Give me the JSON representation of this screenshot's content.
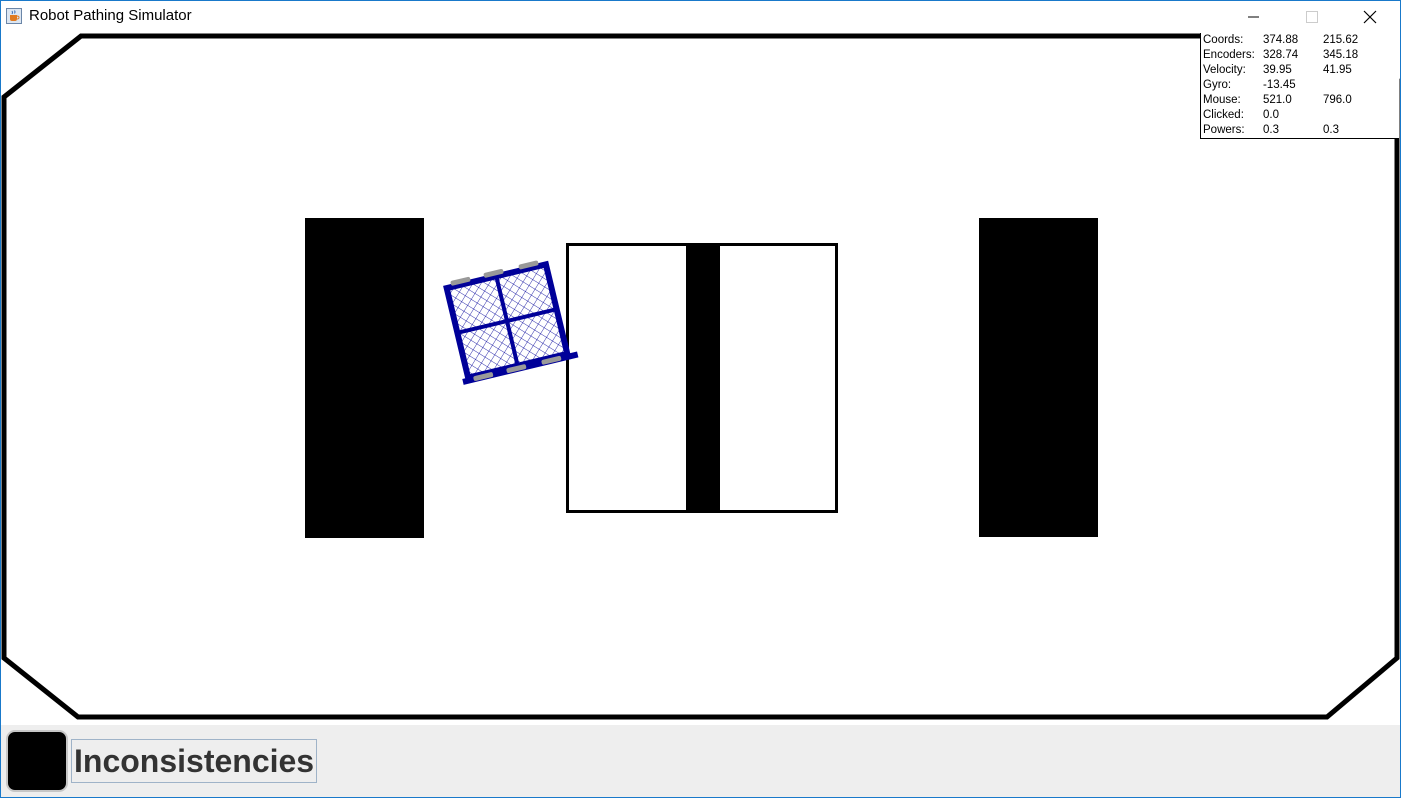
{
  "window": {
    "title": "Robot Pathing Simulator",
    "icon": "java-cup-icon",
    "controls": [
      "minimize-icon",
      "maximize-icon",
      "close-icon"
    ]
  },
  "telemetry": {
    "rows": [
      {
        "label": "Coords:",
        "v1": "374.88",
        "v2": "215.62"
      },
      {
        "label": "Encoders:",
        "v1": "328.74",
        "v2": "345.18"
      },
      {
        "label": "Velocity:",
        "v1": "39.95",
        "v2": "41.95"
      },
      {
        "label": "Gyro:",
        "v1": "-13.45",
        "v2": ""
      },
      {
        "label": "Mouse:",
        "v1": "521.0",
        "v2": "796.0"
      },
      {
        "label": "Clicked:",
        "v1": "0.0",
        "v2": ""
      },
      {
        "label": "Powers:",
        "v1": "0.3",
        "v2": "0.3"
      }
    ]
  },
  "robot": {
    "color": "#000099",
    "wheel_color": "#999999"
  },
  "field": {
    "border_color": "#000000",
    "obstacle_color": "#000000"
  },
  "bottom": {
    "swatch_color": "#000000",
    "status_text": "Inconsistencies"
  }
}
